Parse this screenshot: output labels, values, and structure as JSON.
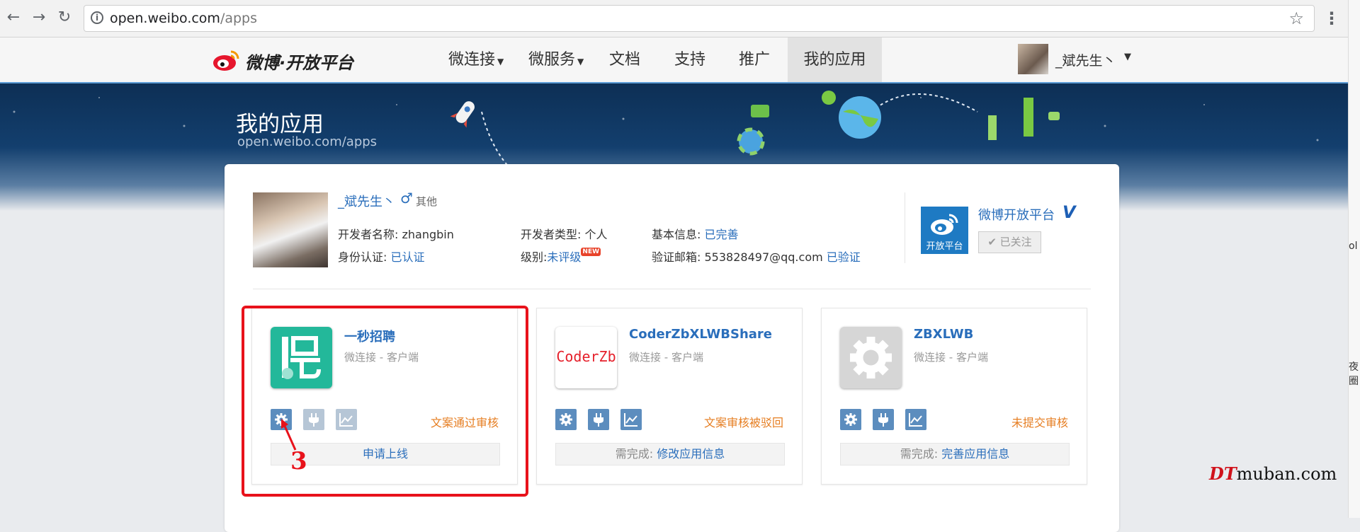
{
  "browser": {
    "url_host": "open.weibo.com",
    "url_path": "/apps"
  },
  "right_edge_fragments": [
    "ol",
    "夜圈"
  ],
  "nav": {
    "logo_text": "微博·开放平台",
    "items": [
      {
        "label": "微连接",
        "dropdown": true
      },
      {
        "label": "微服务",
        "dropdown": true
      },
      {
        "label": "文档",
        "dropdown": false
      },
      {
        "label": "支持",
        "dropdown": false
      },
      {
        "label": "推广",
        "dropdown": false
      },
      {
        "label": "我的应用",
        "dropdown": false,
        "active": true
      }
    ],
    "username": "_斌先生丶"
  },
  "banner": {
    "title": "我的应用",
    "subtitle": "open.weibo.com/apps"
  },
  "developer": {
    "name": "_斌先生丶",
    "gender_icon": "male-icon",
    "gender_text": "其他",
    "fields": {
      "dev_name_label": "开发者名称:",
      "dev_name_value": "zhangbin",
      "dev_type_label": "开发者类型:",
      "dev_type_value": "个人",
      "basic_info_label": "基本信息:",
      "basic_info_value": "已完善",
      "id_auth_label": "身份认证:",
      "id_auth_value": "已认证",
      "level_label": "级别:",
      "level_value": "未评级",
      "level_badge": "NEW",
      "email_label": "验证邮箱:",
      "email_value": "553828497@qq.com",
      "email_status": "已验证"
    }
  },
  "platform": {
    "logo_label": "开放平台",
    "name": "微博开放平台",
    "verified_mark": "V",
    "follow_label": "已关注"
  },
  "apps": [
    {
      "name": "一秒招聘",
      "type": "微连接 - 客户端",
      "status": "文案通过审核",
      "action_prefix": "",
      "action_link": "申请上线"
    },
    {
      "name": "CoderZbXLWBShare",
      "type": "微连接 - 客户端",
      "icon_text": "CoderZb",
      "status": "文案审核被驳回",
      "action_prefix": "需完成:",
      "action_link": "修改应用信息"
    },
    {
      "name": "ZBXLWB",
      "type": "微连接 - 客户端",
      "status": "未提交审核",
      "action_prefix": "需完成:",
      "action_link": "完善应用信息"
    }
  ],
  "annotation": {
    "step": "3"
  },
  "watermark": {
    "dt": "DT",
    "rest": "muban.com"
  },
  "colors": {
    "link_blue": "#2a6ebb",
    "status_orange": "#e67e22",
    "highlight_red": "#e8121b",
    "app1_icon_bg": "#23b89a"
  }
}
